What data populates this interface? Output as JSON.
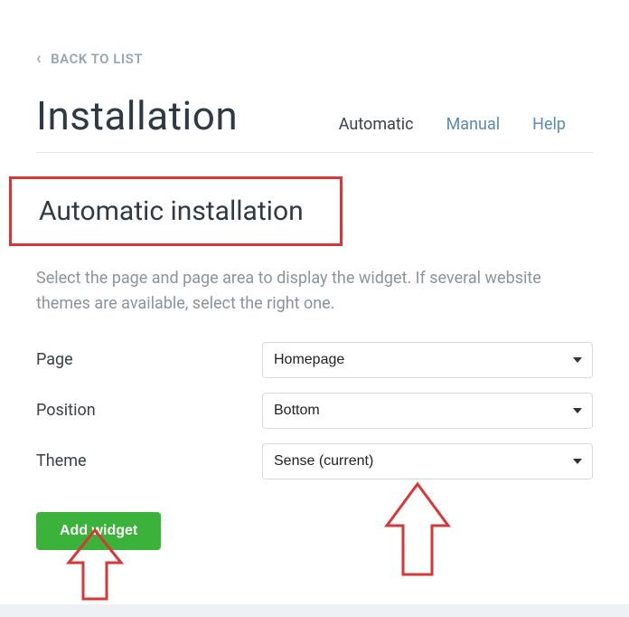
{
  "nav": {
    "back_label": "BACK TO LIST"
  },
  "header": {
    "title": "Installation",
    "tabs": {
      "automatic": "Automatic",
      "manual": "Manual",
      "help": "Help"
    }
  },
  "section": {
    "title": "Automatic installation",
    "help": "Select the page and page area to display the widget. If several website themes are available, select the right one."
  },
  "form": {
    "page_label": "Page",
    "page_value": "Homepage",
    "position_label": "Position",
    "position_value": "Bottom",
    "theme_label": "Theme",
    "theme_value": "Sense (current)",
    "submit_label": "Add widget"
  }
}
